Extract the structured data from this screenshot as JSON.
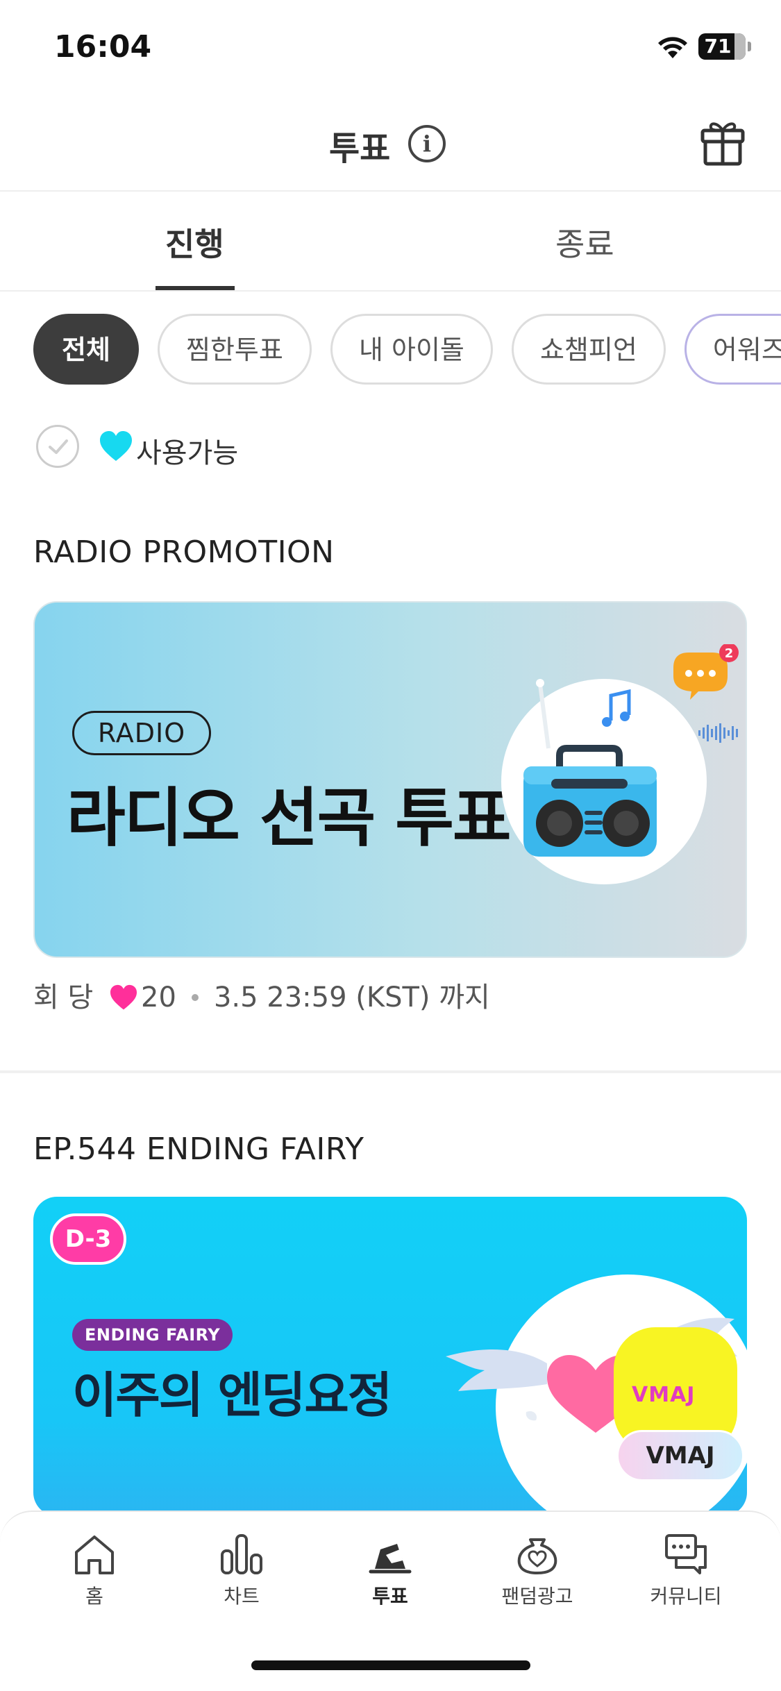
{
  "status_bar": {
    "time": "16:04",
    "battery": "71"
  },
  "header": {
    "title": "투표"
  },
  "tabs": [
    {
      "label": "진행",
      "active": true
    },
    {
      "label": "종료",
      "active": false
    }
  ],
  "filters": [
    {
      "label": "전체",
      "active": true
    },
    {
      "label": "찜한투표",
      "active": false
    },
    {
      "label": "내 아이돌",
      "active": false
    },
    {
      "label": "쇼챔피언",
      "active": false
    },
    {
      "label": "어워즈",
      "active": false
    }
  ],
  "available_filter": {
    "label": "사용가능",
    "checked": false
  },
  "sections": [
    {
      "title": "RADIO PROMOTION",
      "banner": {
        "tag": "RADIO",
        "heading": "라디오 선곡 투표",
        "notification_count": "2"
      },
      "meta": {
        "prefix": "회 당",
        "cost": "20",
        "deadline": "3.5 23:59 (KST) 까지"
      }
    },
    {
      "title": "EP.544 ENDING FAIRY",
      "banner": {
        "dday": "D-3",
        "tag": "ENDING FAIRY",
        "heading": "이주의 엔딩요정",
        "logo": "VMAJ",
        "logo_label": "VMAJ"
      }
    }
  ],
  "bottom_nav": [
    {
      "label": "홈",
      "icon": "home-icon",
      "active": false
    },
    {
      "label": "차트",
      "icon": "chart-icon",
      "active": false
    },
    {
      "label": "투표",
      "icon": "vote-icon",
      "active": true
    },
    {
      "label": "팬덤광고",
      "icon": "fandom-ad-icon",
      "active": false
    },
    {
      "label": "커뮤니티",
      "icon": "community-icon",
      "active": false
    }
  ],
  "colors": {
    "accent_heart_cyan": "#17d9f0",
    "accent_heart_pink": "#ff2f9a",
    "dday_pink": "#ff3ca6"
  }
}
